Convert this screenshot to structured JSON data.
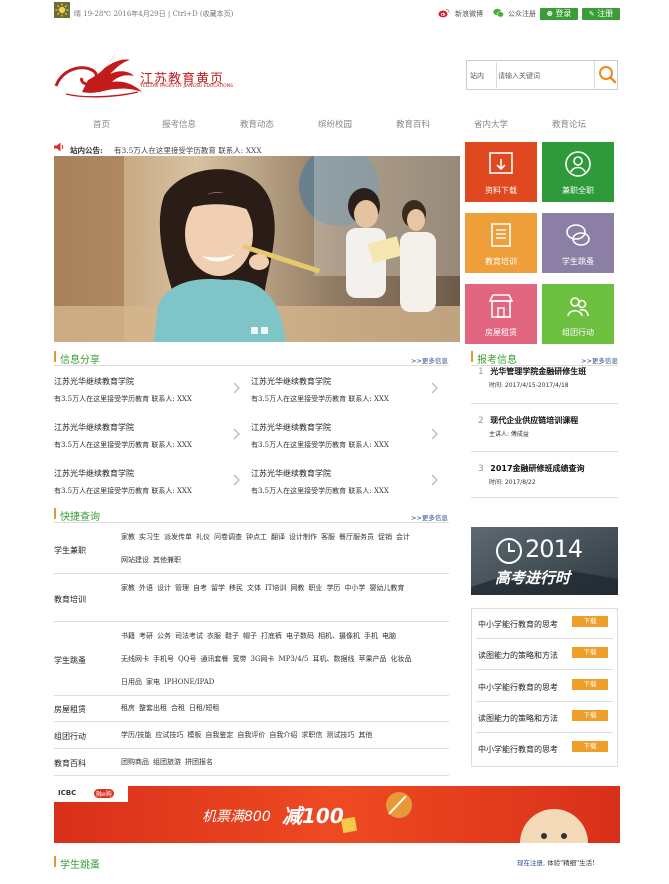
{
  "topbar": {
    "weather": "晴 19-28℃ 2016年4月29日 | Ctrl+D (收藏本页)",
    "weibo": "新浪微博",
    "wechat": "公众注册",
    "login": "登录",
    "register": "注册"
  },
  "header": {
    "logo_cn": "江苏教育黄页",
    "logo_en": "YELLOW PAGES OF JIANGSU EDUCATIONS",
    "search_scope": "站内",
    "search_placeholder": "请输入关键词"
  },
  "nav": [
    "首页",
    "报考信息",
    "教育动态",
    "缤纷校园",
    "教育百科",
    "省内大学",
    "教育论坛"
  ],
  "notice": {
    "label": "站内公告:",
    "text": "有3.5万人在这里接受学历教育 联系人: XXX"
  },
  "tiles": [
    {
      "label": "资料下载",
      "color": "#e0481f",
      "icon": "download-icon"
    },
    {
      "label": "兼职全职",
      "color": "#2e9a3a",
      "icon": "user-icon"
    },
    {
      "label": "教育培训",
      "color": "#ee9f3a",
      "icon": "document-icon"
    },
    {
      "label": "学生跳蚤",
      "color": "#8c7fa6",
      "icon": "chat-icon"
    },
    {
      "label": "房屋租赁",
      "color": "#e26680",
      "icon": "store-icon"
    },
    {
      "label": "组团行动",
      "color": "#6cbf3f",
      "icon": "group-icon"
    }
  ],
  "info": {
    "title": "信息分享",
    "more": ">>更多信息",
    "items": [
      {
        "title": "江苏光华继续教育学院",
        "text": "有3.5万人在这里接受学历教育 联系人: XXX"
      },
      {
        "title": "江苏光华继续教育学院",
        "text": "有3.5万人在这里接受学历教育 联系人: XXX"
      },
      {
        "title": "江苏光华继续教育学院",
        "text": "有3.5万人在这里接受学历教育 联系人: XXX"
      },
      {
        "title": "江苏光华继续教育学院",
        "text": "有3.5万人在这里接受学历教育 联系人: XXX"
      },
      {
        "title": "江苏光华继续教育学院",
        "text": "有3.5万人在这里接受学历教育 联系人: XXX"
      },
      {
        "title": "江苏光华继续教育学院",
        "text": "有3.5万人在这里接受学历教育 联系人: XXX"
      }
    ]
  },
  "kaoshi": {
    "title": "报考信息",
    "more": ">>更多信息",
    "items": [
      {
        "num": "1",
        "title": "光华管理学院金融研修生班",
        "meta": "时间: 2017/4/15-2017/4/18"
      },
      {
        "num": "2",
        "title": "现代企业供应链培训课程",
        "meta": "主讲人: 傅成益"
      },
      {
        "num": "3",
        "title": "2017金融研修班成绩查询",
        "meta": "时间: 2017/8/22"
      }
    ]
  },
  "quick": {
    "title": "快捷查询",
    "more": ">>更多信息",
    "rows": [
      {
        "cat": "学生兼职",
        "links": [
          "家教",
          "实习生",
          "派发传单",
          "礼仪",
          "问卷调查",
          "钟点工",
          "翻译",
          "设计制作",
          "客服",
          "餐厅服务员",
          "促销",
          "会计",
          "网站建设",
          "其他兼职"
        ]
      },
      {
        "cat": "教育培训",
        "links": [
          "家教",
          "外语",
          "设计",
          "管理",
          "自考",
          "留学",
          "移民",
          "文体",
          "IT培训",
          "网教",
          "职业",
          "学历",
          "中小学",
          "婴幼儿教育"
        ]
      },
      {
        "cat": "学生跳蚤",
        "links": [
          "书籍",
          "考研",
          "公务",
          "司法考试",
          "衣服",
          "鞋子",
          "帽子",
          "打底裤",
          "电子数码",
          "相机、摄像机",
          "手机",
          "电脑",
          "无线网卡",
          "手机号",
          "QQ号",
          "通讯套餐",
          "宽带",
          "3G网卡",
          "MP3/4/5",
          "耳机、数据线",
          "苹果产品",
          "化妆品",
          "日用品",
          "家电",
          "IPHONE/IPAD"
        ]
      },
      {
        "cat": "房屋租赁",
        "links": [
          "租房",
          "整套出租",
          "合租",
          "日租/短租"
        ]
      },
      {
        "cat": "组团行动",
        "links": [
          "学历/技能",
          "应试技巧",
          "模板",
          "自我鉴定",
          "自我评价",
          "自我介绍",
          "求职信",
          "测试技巧",
          "其他"
        ]
      },
      {
        "cat": "教育百科",
        "links": [
          "团购商品",
          "组团旅游",
          "拼团报名"
        ]
      }
    ]
  },
  "promo": {
    "year": "2014",
    "text": "高考进行时"
  },
  "downloads": {
    "items": [
      {
        "title": "中小学能行教育的思考",
        "btn": "下载"
      },
      {
        "title": "读图能力的策略和方法",
        "btn": "下载"
      },
      {
        "title": "中小学能行教育的思考",
        "btn": "下载"
      },
      {
        "title": "读图能力的策略和方法",
        "btn": "下载"
      },
      {
        "title": "中小学能行教育的思考",
        "btn": "下载"
      }
    ]
  },
  "ad": {
    "bank": "ICBC",
    "brand": "融e购",
    "text": "机票满800",
    "highlight": "减100"
  },
  "bottom": {
    "title": "学生跳蚤",
    "register_link": "现在注册",
    "register_text": ", 体验\"精细\"生活!"
  }
}
